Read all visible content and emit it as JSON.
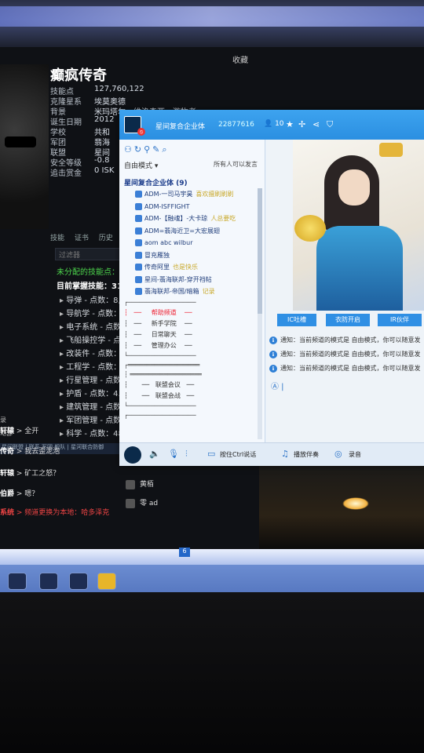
{
  "eve": {
    "collect": "收藏",
    "char_name": "癫疯传奇",
    "stats": [
      {
        "label": "技能点",
        "value": "127,760,122"
      },
      {
        "label": "克隆星系",
        "value": "埃莫奥德"
      },
      {
        "label": "背景",
        "value": "米玛塔尔 - 维洛森亚 - 游牧者"
      },
      {
        "label": "诞生日期",
        "value": "2012"
      },
      {
        "label": "学校",
        "value": "共和"
      },
      {
        "label": "军团",
        "value": "翡海"
      },
      {
        "label": "联盟",
        "value": "星间"
      },
      {
        "label": "安全等级",
        "value": "-0.8"
      },
      {
        "label": "追击赏金",
        "value": "0 ISK"
      }
    ],
    "tabs": [
      "技能",
      "证书",
      "历史"
    ],
    "filter_placeholder": "过滤器",
    "unassigned": "未分配的技能点：",
    "current_skills": "目前掌握技能：31",
    "skills": [
      "导弹 - 点数：8,7",
      "导航学 - 点数：",
      "电子系统 - 点数",
      "飞船操控学 - 点数",
      "改装件 - 点数：5",
      "工程学 - 点数：5",
      "行星管理 - 点数",
      "护盾 - 点数：4.3",
      "建筑管理 - 点数",
      "军团管理 - 点数",
      "科学 - 点数：48"
    ],
    "left_edge": [
      "录",
      "动部"
    ],
    "chat_tabs": "星间联盟 | 联系 军团 舰队 | 星河联合防御",
    "chat_lines": [
      {
        "name": "轩辕",
        "text": " > 全开"
      },
      {
        "name": "传奇",
        "text": " > 我去歪泥泡"
      },
      {
        "name": "轩辕",
        "text": " > 矿工之怒？"
      },
      {
        "name": "伯爵",
        "text": " > 嗯？"
      },
      {
        "name": "系统",
        "text": " > 频道更换为本地：哈多泽克"
      }
    ],
    "members": [
      "黄栢",
      "零 ad"
    ]
  },
  "taskbar": {
    "badge": "6"
  },
  "yy": {
    "channel_name": "星间复合企业体",
    "channel_id": "22877616",
    "user_count": "10",
    "mode": "自由模式 ▾",
    "all_can_speak": "所有人可以发言",
    "root": "星间复合企业体 (9)",
    "users": [
      {
        "name": "ADM-一司马宇昊",
        "note": "喜欢擅刷刷刷"
      },
      {
        "name": "ADM-ISFFIGHT",
        "note": ""
      },
      {
        "name": "ADM-【融魂】-大卡琼",
        "note": "人总要吃"
      },
      {
        "name": "ADM=翡海近卫=大宏展翅",
        "note": ""
      },
      {
        "name": "aom abc wilbur",
        "note": ""
      },
      {
        "name": "冒充雁独",
        "note": ""
      },
      {
        "name": "传奇阿里",
        "note": "也是快乐"
      },
      {
        "name": "星间-翡海联邦-穿开裆帖",
        "note": ""
      },
      {
        "name": "翡海联邦-帝国/暗箱",
        "note": "记录"
      }
    ],
    "channels": [
      "帮助频道",
      "新手学院",
      "日常聊天",
      "管理办公",
      "联盟会议",
      "联盟会战"
    ],
    "buttons": [
      "IC吐槽",
      "衣防开启",
      "IR伙伴"
    ],
    "notices": [
      "通知：当前频道的模式是 自由模式，你可以随意发",
      "通知：当前频道的模式是 自由模式，你可以随意发",
      "通知：当前频道的模式是 自由模式，你可以随意发"
    ],
    "bottom": {
      "ptt": "按住Ctrl说话",
      "play": "播放伴奏",
      "record": "录音"
    }
  },
  "colors": {
    "yy_title": "#2b8fe1",
    "eve_bg": "#0f1115",
    "taskbar": "#6d8ed2"
  }
}
